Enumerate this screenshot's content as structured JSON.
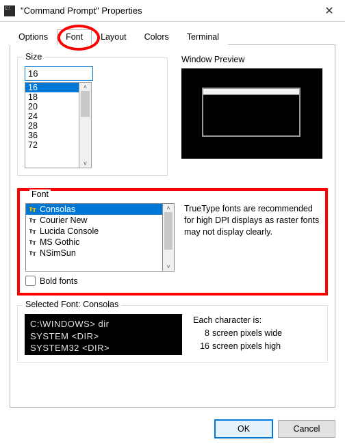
{
  "titlebar": {
    "title": "\"Command Prompt\" Properties"
  },
  "tabs": {
    "items": [
      "Options",
      "Font",
      "Layout",
      "Colors",
      "Terminal"
    ],
    "active": "Font"
  },
  "size": {
    "label": "Size",
    "current": "16",
    "options": [
      "16",
      "18",
      "20",
      "24",
      "28",
      "36",
      "72"
    ]
  },
  "preview": {
    "label": "Window Preview"
  },
  "font": {
    "label": "Font",
    "options": [
      "Consolas",
      "Courier New",
      "Lucida Console",
      "MS Gothic",
      "NSimSun"
    ],
    "selected": "Consolas",
    "boldLabel": "Bold fonts",
    "info": "TrueType fonts are recommended for high DPI displays as raster fonts may not display clearly."
  },
  "selectedFont": {
    "label": "Selected Font: Consolas",
    "sampleLine1": "C:\\WINDOWS> dir",
    "sampleLine2": "SYSTEM       <DIR>",
    "sampleLine3": "SYSTEM32     <DIR>",
    "charLabel": "Each character is:",
    "widthValue": "8",
    "widthText": "screen pixels wide",
    "heightValue": "16",
    "heightText": "screen pixels high"
  },
  "buttons": {
    "ok": "OK",
    "cancel": "Cancel"
  }
}
